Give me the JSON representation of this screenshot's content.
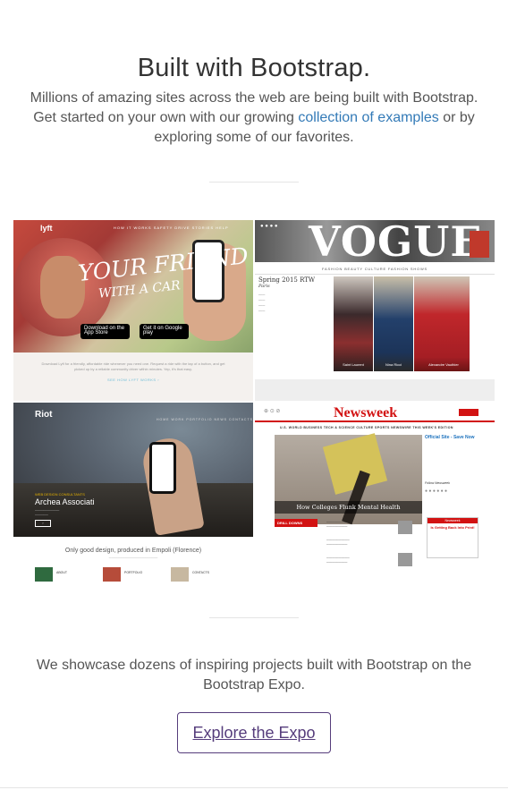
{
  "title": "Built with Bootstrap.",
  "lead": {
    "part1": "Millions of amazing sites across the web are being built with Bootstrap. Get started on your own with our growing ",
    "link": "collection of examples",
    "part2": " or by exploring some of our favorites."
  },
  "showcase": [
    {
      "site": "Lyft",
      "logo": "lyft",
      "nav": "HOW IT WORKS   SAFETY   DRIVE   STORIES   HELP",
      "slogan_line1": "YOUR FRIEND",
      "slogan_line2": "WITH A CAR",
      "app_store": "Download on the App Store",
      "google_play": "Get it on Google play",
      "footer": "Download Lyft for a friendly, affordable ride whenever you need one. Request a ride with the tap of a button, and get picked up by a reliable community driver within minutes. Yep, it's that easy.",
      "more_link": "SEE HOW LYFT WORKS ›"
    },
    {
      "site": "Vogue",
      "logo": "VOGUE",
      "menu": "FASHION   BEAUTY   CULTURE   FASHION SHOWS",
      "heading": "Spring 2015 RTW",
      "subheading": "Paris",
      "captions": [
        "Saint Laurent",
        "Nina Ricci",
        "Alexandre Vauthier"
      ]
    },
    {
      "site": "Riot",
      "logo": "Riot",
      "nav": "HOME   WORK   PORTFOLIO   NEWS   CONTACTS",
      "eyebrow": "WEB DESIGN CONSULTANTS",
      "name": "Archea Associati",
      "tagline": "Only good design, produced in Empoli (Florence)",
      "tiles": [
        "ABOUT",
        "PORTFOLIO",
        "CONTACTS"
      ]
    },
    {
      "site": "Newsweek",
      "logo": "Newsweek",
      "menu": "U.S.   WORLD   BUSINESS   TECH & SCIENCE   CULTURE   SPORTS   NEWSWIRE   THIS WEEK'S EDITION",
      "headline": "How Colleges Flunk Mental Health",
      "section": "DRILL DOWNS",
      "ad_title": "Official Site - Save Now",
      "follow": "Follow Newsweek",
      "promo": "Newsweek",
      "promo_text": "Is Getting Back Into Print!"
    }
  ],
  "showcase_text": "We showcase dozens of inspiring projects built with Bootstrap on the Bootstrap Expo.",
  "expo_button": "Explore the Expo",
  "colors": {
    "link": "#337ab7",
    "brand": "#563d7c",
    "newsweek_red": "#d21212"
  }
}
